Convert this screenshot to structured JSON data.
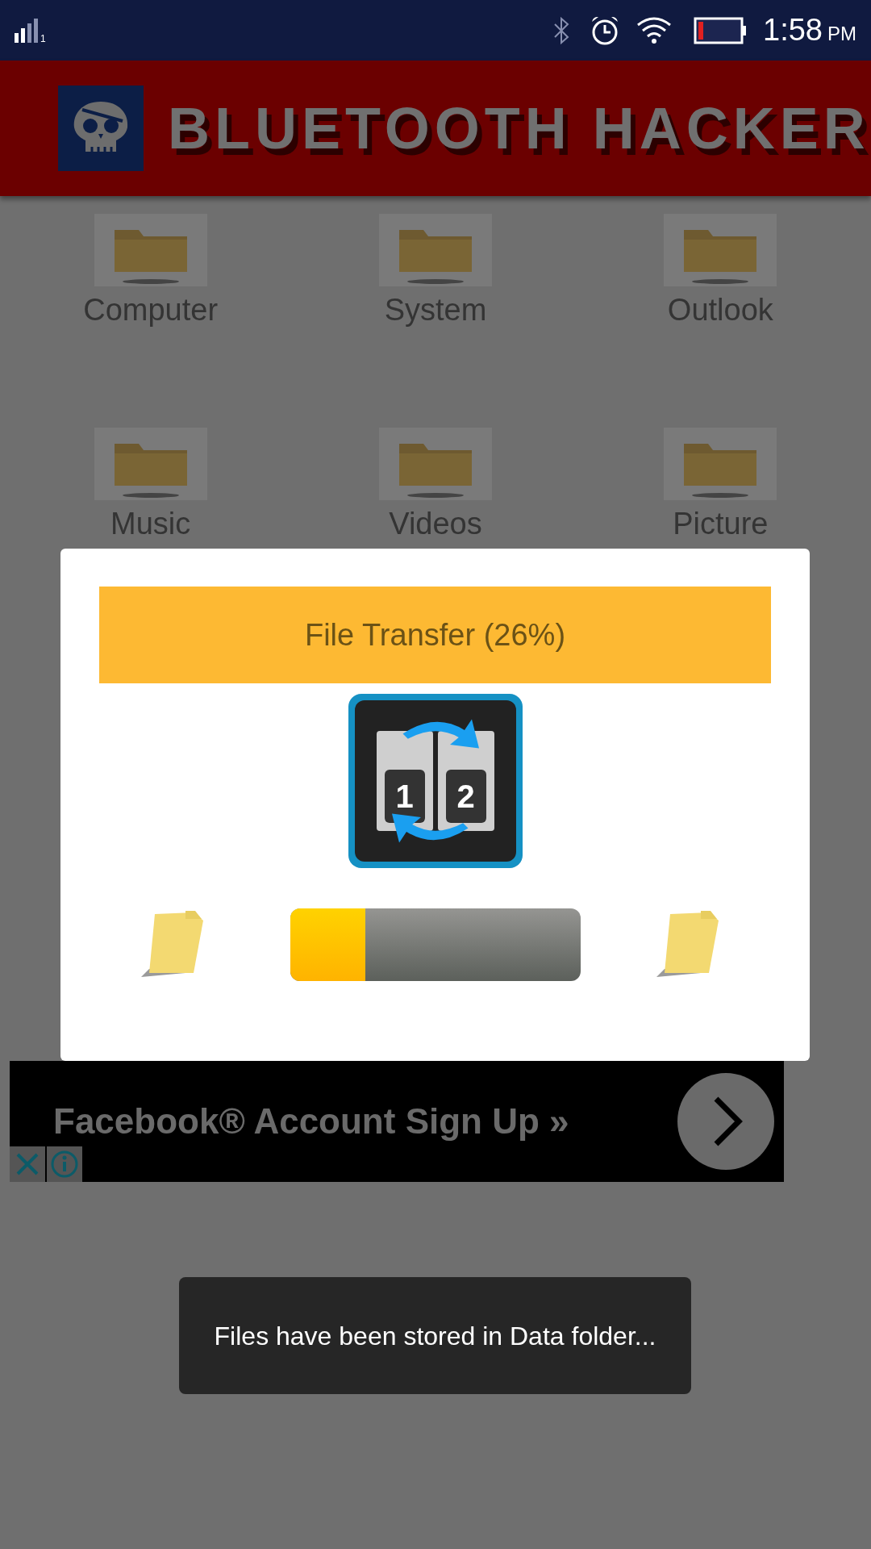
{
  "status_bar": {
    "sim_label": "1",
    "time": "1:58",
    "meridiem": "PM"
  },
  "header": {
    "title": "BLUETOOTH HACKER"
  },
  "folders": [
    {
      "label": "Computer"
    },
    {
      "label": "System"
    },
    {
      "label": "Outlook"
    },
    {
      "label": "Music"
    },
    {
      "label": "Videos"
    },
    {
      "label": "Picture"
    }
  ],
  "dialog": {
    "title": "File Transfer (26%)",
    "icon_digits": [
      "1",
      "2"
    ],
    "progress": {
      "level": 0.26
    }
  },
  "ad": {
    "text": "Facebook® Account Sign Up »"
  },
  "toast": {
    "text": "Files have been stored in Data folder..."
  }
}
